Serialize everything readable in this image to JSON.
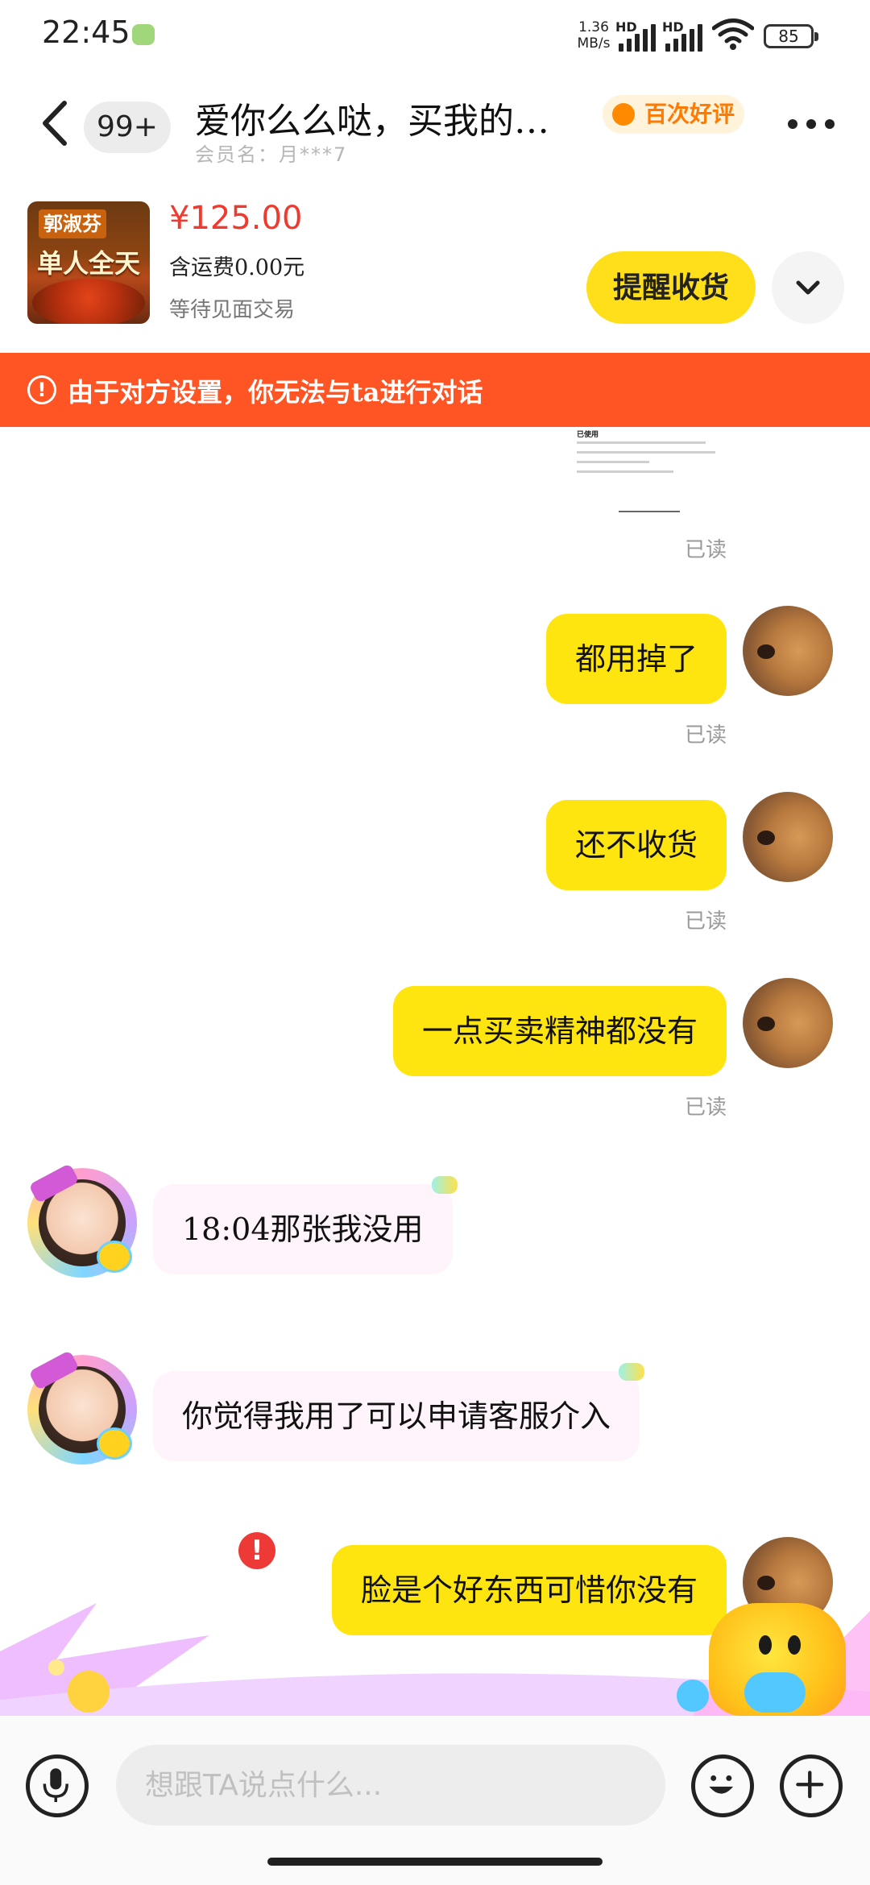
{
  "status_bar": {
    "time": "22:45",
    "net_speed_value": "1.36",
    "net_speed_unit": "MB/s",
    "sim1_label": "HD",
    "sim2_label": "HD",
    "battery": "85"
  },
  "header": {
    "badge": "99+",
    "title": "爱你么么哒，买我的…",
    "member_name": "会员名：月***7",
    "praise_badge": "百次好评"
  },
  "order": {
    "thumb_brand": "郭淑芬",
    "thumb_title": "单人全天",
    "price": "¥125.00",
    "shipping": "含运费0.00元",
    "status": "等待见面交易",
    "remind_button": "提醒收货"
  },
  "warning": {
    "icon": "!",
    "text": "由于对方设置，你无法与ta进行对话"
  },
  "messages": {
    "doc_heading": "已使用",
    "read_label": "已读",
    "out_1": "都用掉了",
    "out_2": "还不收货",
    "out_3": "一点买卖精神都没有",
    "in_1": "18:04那张我没用",
    "in_2": "你觉得我用了可以申请客服介入",
    "out_4": "脸是个好东西可惜你没有",
    "error_icon": "!"
  },
  "input": {
    "placeholder": "想跟TA说点什么..."
  },
  "icons": {
    "back": "chevron-left-icon",
    "more": "more-dots-icon",
    "expand": "chevron-down-icon",
    "voice": "microphone-icon",
    "emoji": "smiley-icon",
    "plus": "plus-icon"
  },
  "colors": {
    "accent_yellow": "#ffe510",
    "warning_red": "#ff5424",
    "price_red": "#ef3b2f",
    "error_red": "#ee3a36"
  }
}
